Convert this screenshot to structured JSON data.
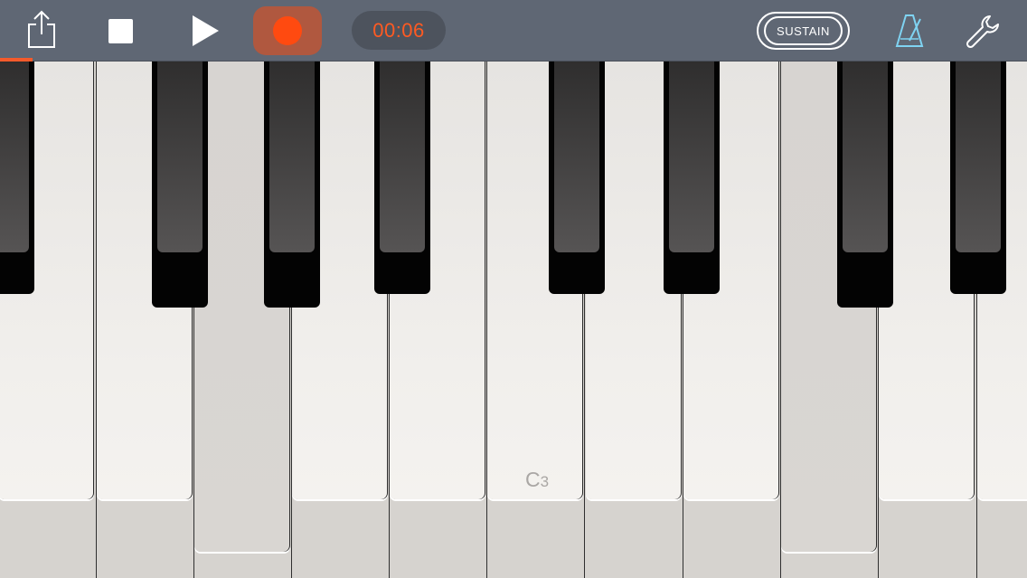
{
  "toolbar": {
    "share_icon": "share-icon",
    "stop_icon": "stop-icon",
    "play_icon": "play-icon",
    "record_icon": "record-icon",
    "timer": "00:06",
    "sustain_label": "SUSTAIN",
    "metronome_icon": "metronome-icon",
    "settings_icon": "wrench-icon",
    "record_color": "#ff4a10",
    "metronome_color": "#7fd3f2"
  },
  "keyboard": {
    "note_label": "C",
    "note_octave": "3",
    "pressed_keys": [
      "white-key-3",
      "white-key-9",
      "black-key-1",
      "black-key-2",
      "black-key-6"
    ]
  }
}
